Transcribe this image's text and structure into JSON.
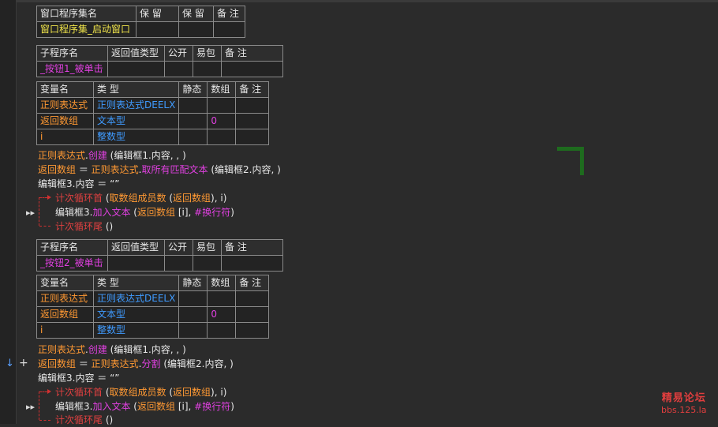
{
  "gutter": {
    "expand_marker": "▸▸",
    "arrow_marker": "↓",
    "plus_marker": "+"
  },
  "assembly_table": {
    "headers": [
      "窗口程序集名",
      "保 留",
      "保 留",
      "备 注"
    ],
    "row": [
      "窗口程序集_启动窗口",
      "",
      "",
      ""
    ]
  },
  "sub1": {
    "headers": [
      "子程序名",
      "返回值类型",
      "公开",
      "易包",
      "备 注"
    ],
    "row": [
      "_按钮1_被单击",
      "",
      "",
      "",
      ""
    ],
    "var_headers": [
      "变量名",
      "类 型",
      "静态",
      "数组",
      "备 注"
    ],
    "vars": [
      [
        "正则表达式",
        "正则表达式DEELX",
        "",
        "",
        ""
      ],
      [
        "返回数组",
        "文本型",
        "",
        "0",
        ""
      ],
      [
        "i",
        "整数型",
        "",
        "",
        ""
      ]
    ],
    "code": {
      "l1_obj": "正则表达式",
      "l1_dot": ".",
      "l1_method": "创建",
      "l1_args": " (编辑框1.内容, , )",
      "l2_var": "返回数组",
      "l2_eq": " ＝ ",
      "l2_obj": "正则表达式",
      "l2_dot": ".",
      "l2_method": "取所有匹配文本",
      "l2_args": " (编辑框2.内容, )",
      "l3_lhs": "编辑框3.内容",
      "l3_eq": " ＝ ",
      "l3_val": "“”",
      "l4_loop": "计次循环首",
      "l4_open": " (",
      "l4_fn": "取数组成员数",
      "l4_paren": " (",
      "l4_var": "返回数组",
      "l4_tail": "), i)",
      "l5_obj": "编辑框3",
      "l5_dot": ".",
      "l5_method": "加入文本",
      "l5_open": " (",
      "l5_var": "返回数组",
      "l5_idx": " [i], ",
      "l5_const": "#换行符",
      "l5_close": ")",
      "l6_loop": "计次循环尾",
      "l6_args": " ()"
    }
  },
  "sub2": {
    "headers": [
      "子程序名",
      "返回值类型",
      "公开",
      "易包",
      "备 注"
    ],
    "row": [
      "_按钮2_被单击",
      "",
      "",
      "",
      ""
    ],
    "var_headers": [
      "变量名",
      "类 型",
      "静态",
      "数组",
      "备 注"
    ],
    "vars": [
      [
        "正则表达式",
        "正则表达式DEELX",
        "",
        "",
        ""
      ],
      [
        "返回数组",
        "文本型",
        "",
        "0",
        ""
      ],
      [
        "i",
        "整数型",
        "",
        "",
        ""
      ]
    ],
    "code": {
      "l1_obj": "正则表达式",
      "l1_dot": ".",
      "l1_method": "创建",
      "l1_args": " (编辑框1.内容, , )",
      "l2_var": "返回数组",
      "l2_eq": " ＝ ",
      "l2_obj": "正则表达式",
      "l2_dot": ".",
      "l2_method": "分割",
      "l2_args": " (编辑框2.内容, )",
      "l3_lhs": "编辑框3.内容",
      "l3_eq": " ＝ ",
      "l3_val": "“”",
      "l4_loop": "计次循环首",
      "l4_open": " (",
      "l4_fn": "取数组成员数",
      "l4_paren": " (",
      "l4_var": "返回数组",
      "l4_tail": "), i)",
      "l5_obj": "编辑框3",
      "l5_dot": ".",
      "l5_method": "加入文本",
      "l5_open": " (",
      "l5_var": "返回数组",
      "l5_idx": " [i], ",
      "l5_const": "#换行符",
      "l5_close": ")",
      "l6_loop": "计次循环尾",
      "l6_args": " ()"
    }
  },
  "watermark": {
    "line1": "精易论坛",
    "line2": "bbs.125.la"
  }
}
